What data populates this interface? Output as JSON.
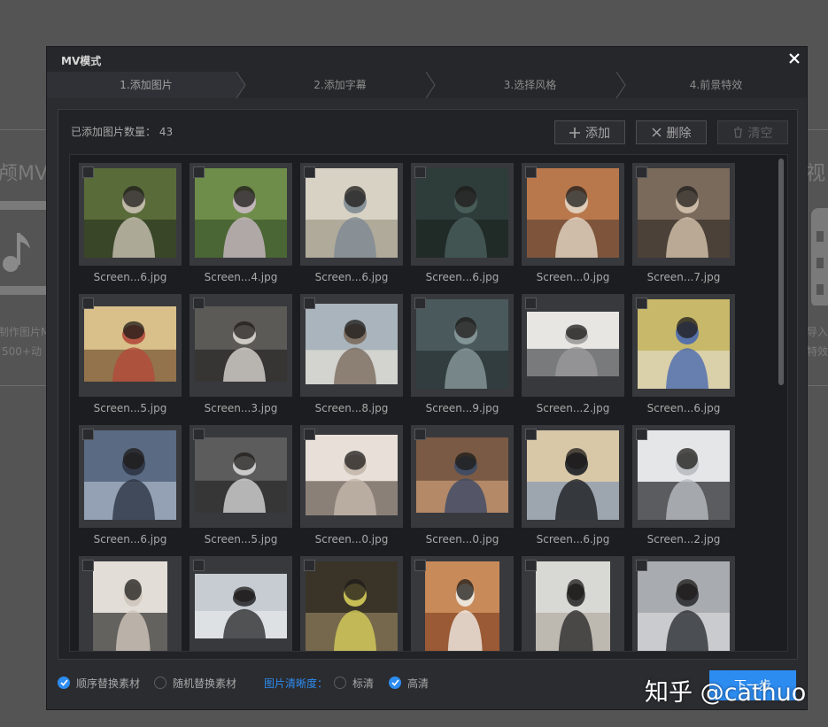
{
  "background": {
    "left_title": "颅MV",
    "right_title": "视",
    "left_line1": "制作图片M",
    "left_line2": "500+动",
    "right_line1": "导入",
    "right_line2": "特效"
  },
  "dialog": {
    "title": "MV模式",
    "steps": [
      "1.添加图片",
      "2.添加字幕",
      "3.选择风格",
      "4.前景特效"
    ],
    "count_label": "已添加图片数量：",
    "count_value": "43",
    "buttons": {
      "add": "添加",
      "delete": "删除",
      "clear": "清空"
    },
    "thumbnails": [
      {
        "caption": "Screen...6.jpg"
      },
      {
        "caption": "Screen...4.jpg"
      },
      {
        "caption": "Screen...6.jpg"
      },
      {
        "caption": "Screen...6.jpg"
      },
      {
        "caption": "Screen...0.jpg"
      },
      {
        "caption": "Screen...7.jpg"
      },
      {
        "caption": "Screen...5.jpg"
      },
      {
        "caption": "Screen...3.jpg"
      },
      {
        "caption": "Screen...8.jpg"
      },
      {
        "caption": "Screen...9.jpg"
      },
      {
        "caption": "Screen...2.jpg"
      },
      {
        "caption": "Screen...6.jpg"
      },
      {
        "caption": "Screen...6.jpg"
      },
      {
        "caption": "Screen...5.jpg"
      },
      {
        "caption": "Screen...0.jpg"
      },
      {
        "caption": "Screen...0.jpg"
      },
      {
        "caption": "Screen...6.jpg"
      },
      {
        "caption": "Screen...2.jpg"
      },
      {
        "caption": ""
      },
      {
        "caption": ""
      },
      {
        "caption": ""
      },
      {
        "caption": ""
      },
      {
        "caption": ""
      },
      {
        "caption": ""
      }
    ],
    "options": {
      "sequential_replace": "顺序替换素材",
      "random_replace": "随机替换素材",
      "clarity_label": "图片清晰度：",
      "standard": "标清",
      "high": "高清",
      "sequential_checked": true,
      "random_checked": false,
      "standard_checked": false,
      "high_checked": true
    },
    "next_button": "下一步"
  },
  "watermark": "知乎 @cathuo",
  "colors": {
    "accent": "#2d8cf0",
    "dialog_bg": "#2b2c30",
    "panel_bg": "#222326"
  }
}
